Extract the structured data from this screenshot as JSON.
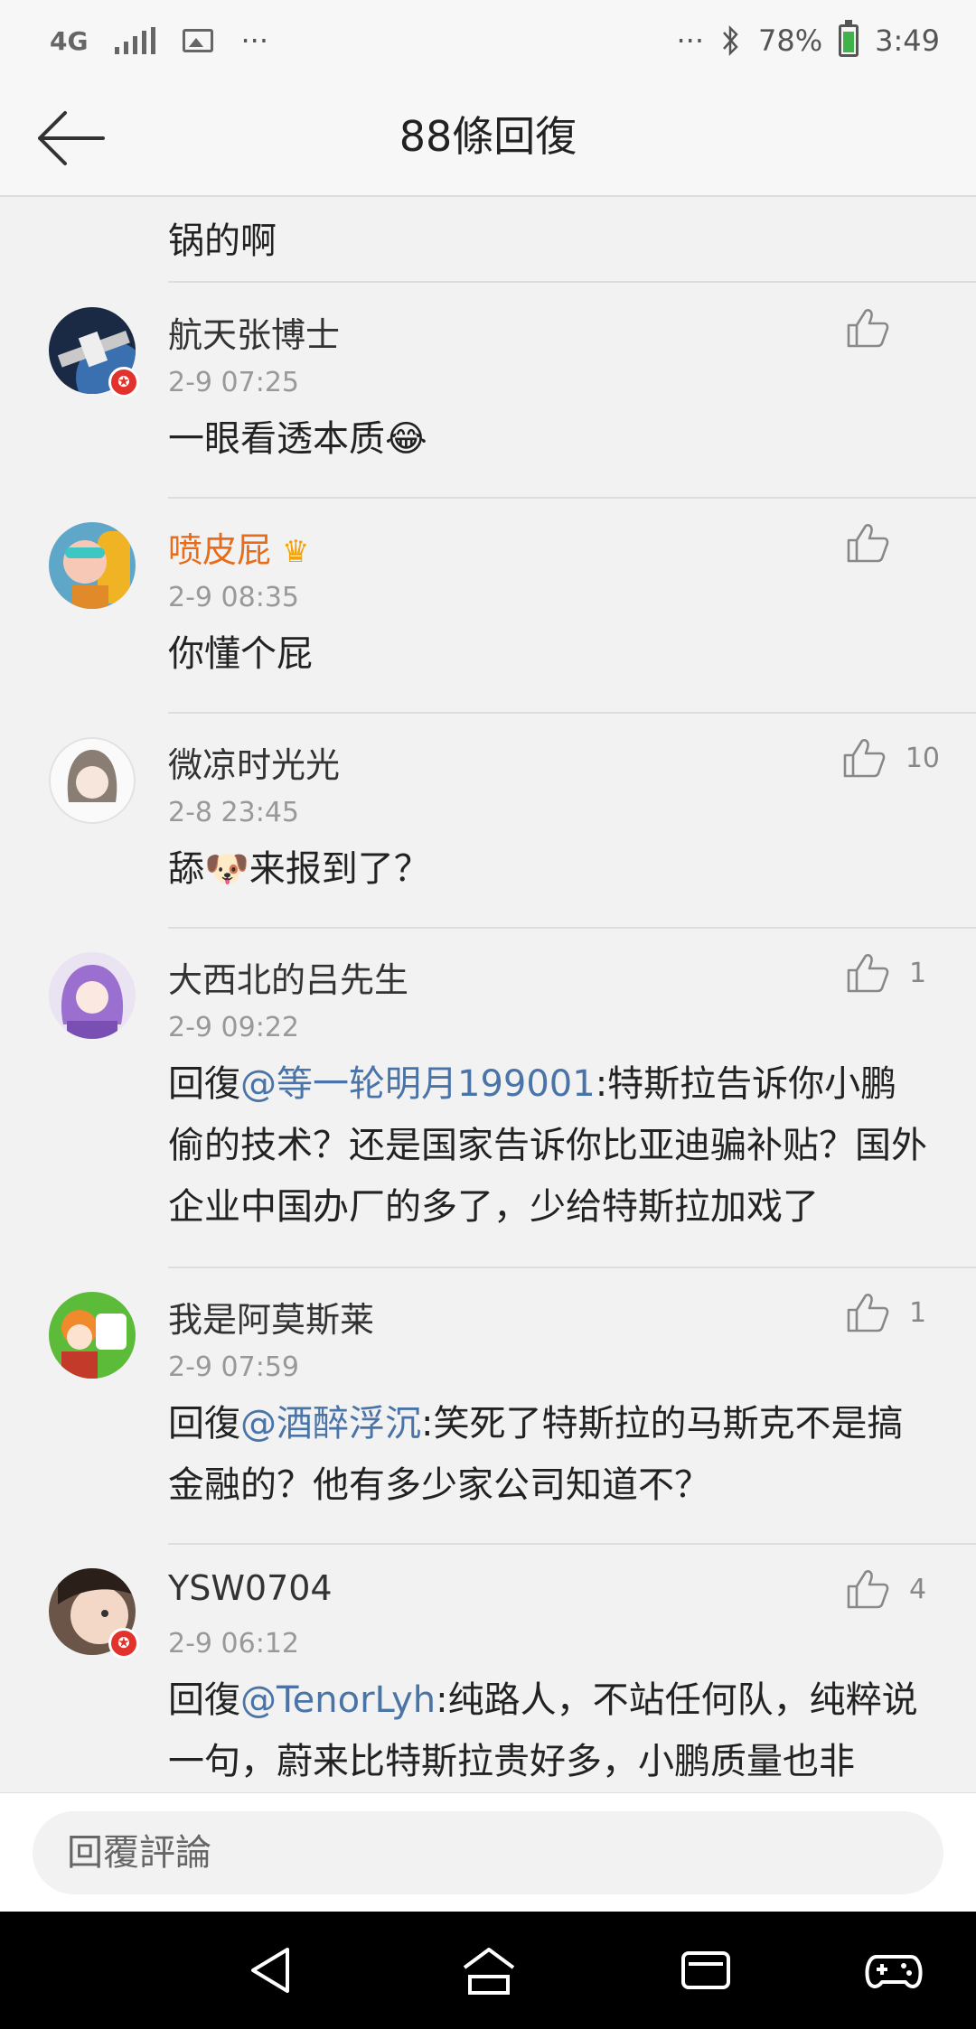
{
  "status_bar": {
    "network": "4G",
    "more_left": "···",
    "more_right": "···",
    "battery": "78%",
    "time": "3:49",
    "battery_color": "#3fb24a"
  },
  "header": {
    "title": "88條回復"
  },
  "partial_comment": {
    "text": "锅的啊"
  },
  "comments": [
    {
      "name": "航天张博士",
      "time": "2-9 07:25",
      "text": "一眼看透本质😂",
      "likes": ""
    },
    {
      "name": "喷皮屁",
      "time": "2-9 08:35",
      "text": "你懂个屁",
      "likes": "",
      "name_color": "#e86c19",
      "crown": "♛"
    },
    {
      "name": "微凉时光光",
      "time": "2-8 23:45",
      "text": "舔🐶来报到了？",
      "likes": "10"
    },
    {
      "name": "大西北的吕先生",
      "time": "2-9 09:22",
      "reply_prefix": "回復",
      "mention": "@等一轮明月199001",
      "text": ":特斯拉告诉你小鹏偷的技术？还是国家告诉你比亚迪骗补贴？国外企业中国办厂的多了，少给特斯拉加戏了",
      "likes": "1"
    },
    {
      "name": "我是阿莫斯莱",
      "time": "2-9 07:59",
      "reply_prefix": "回復",
      "mention": "@酒醉浮沉",
      "text": ":笑死了特斯拉的马斯克不是搞金融的？他有多少家公司知道不？",
      "likes": "1"
    },
    {
      "name": "YSW0704",
      "time": "2-9 06:12",
      "reply_prefix": "回復",
      "mention": "@TenorLyh",
      "text": ":纯路人，不站任何队，纯粹说一句，蔚来比特斯拉贵好多，小鹏质量也非",
      "likes": "4"
    }
  ],
  "reply_bar": {
    "placeholder": "回覆評論"
  },
  "icons": {
    "back": "arrow-left-icon",
    "like": "thumbs-up-icon",
    "nav": [
      "back-triangle-icon",
      "home-icon",
      "recents-icon",
      "gamepad-icon"
    ]
  }
}
